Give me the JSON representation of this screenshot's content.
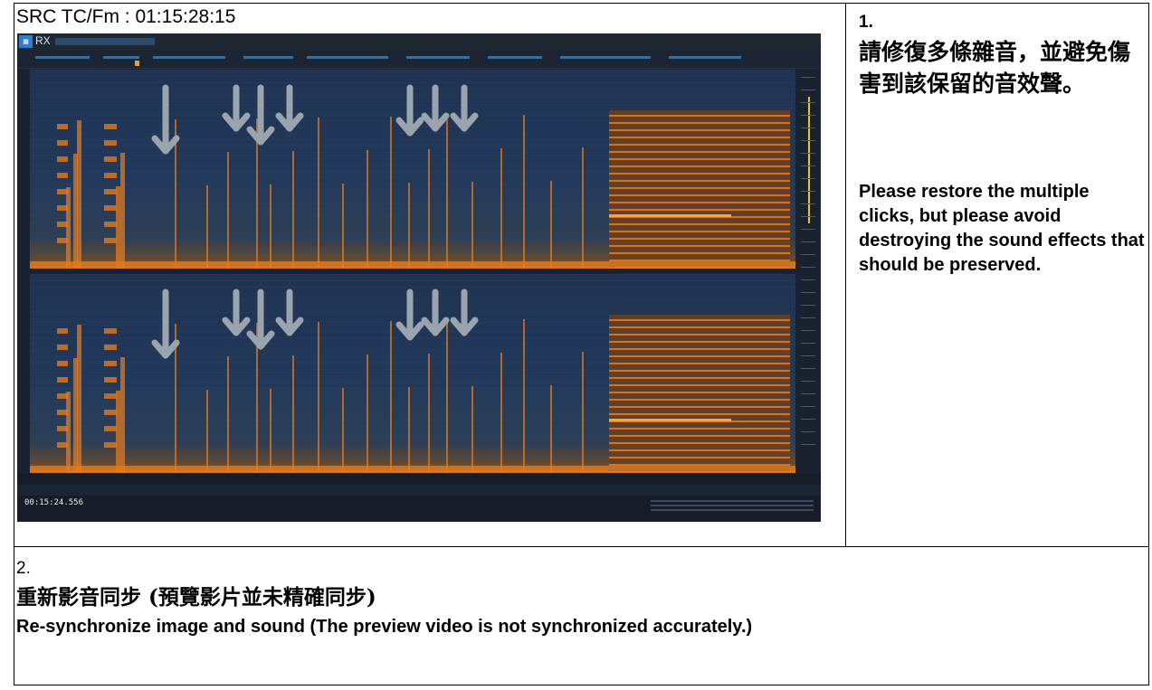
{
  "cell1": {
    "timecode_label": "SRC TC/Fm : 01:15:28:15",
    "screenshot": {
      "app_name": "RX",
      "clock": "00:15:24.556",
      "icons": [
        "rx-logo-icon",
        "down-arrow-icon"
      ],
      "colors": {
        "background": "#1a2230",
        "spectrogram_low": "#1f3252",
        "spectrogram_energy": "#e07a1f",
        "accent": "#2b7fd3",
        "arrow": "#9aa4ae"
      }
    }
  },
  "cell2": {
    "number": "1.",
    "text_zh": "請修復多條雜音，並避免傷害到該保留的音效聲。",
    "text_en": "Please restore the multiple clicks, but please avoid destroying the sound effects that should be preserved."
  },
  "cell3": {
    "number": "2.",
    "text_zh": "重新影音同步 (預覽影片並未精確同步)",
    "text_en": "Re-synchronize image and sound (The preview video is not synchronized accurately.)"
  }
}
